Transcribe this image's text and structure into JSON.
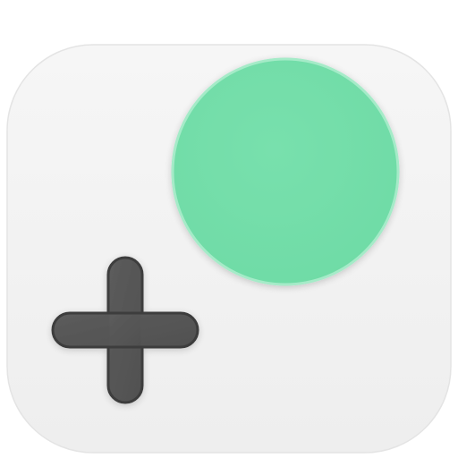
{
  "icon": {
    "name": "add-app-icon",
    "background_color": "#f5f5f5",
    "background_edge_color": "#e4e4e4",
    "accent_color": "#6fdba6",
    "accent_edge_color": "#a5ebc8",
    "plus_color": "#5c5c5c",
    "plus_edge_color": "#3e3e3e"
  }
}
